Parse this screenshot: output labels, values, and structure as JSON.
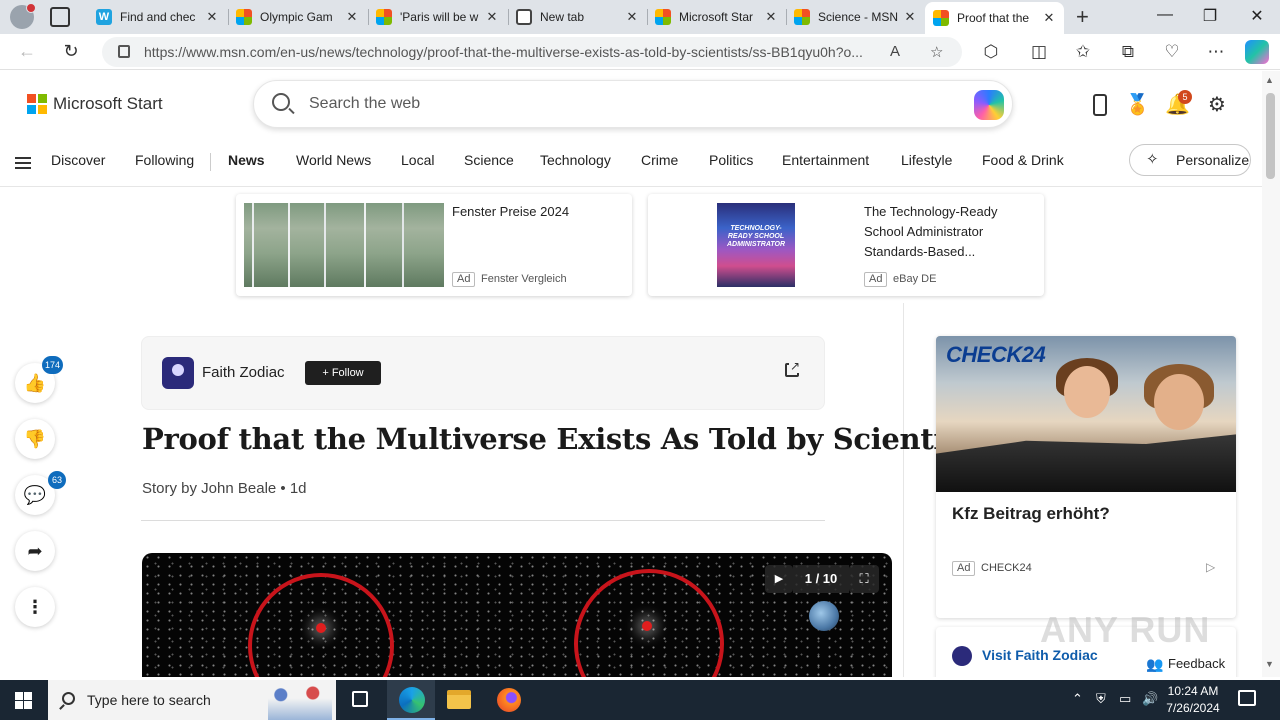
{
  "browser": {
    "tabs": [
      {
        "title": "Find and chec",
        "favicon": "w-icon"
      },
      {
        "title": "Olympic Gam",
        "favicon": "msn-icon"
      },
      {
        "title": "'Paris will be w",
        "favicon": "msn-icon"
      },
      {
        "title": "New tab",
        "favicon": "newtab-icon"
      },
      {
        "title": "Microsoft Star",
        "favicon": "msn-icon"
      },
      {
        "title": "Science - MSN",
        "favicon": "msn-icon"
      },
      {
        "title": "Proof that the",
        "favicon": "msn-icon",
        "active": true
      }
    ],
    "url": "https://www.msn.com/en-us/news/technology/proof-that-the-multiverse-exists-as-told-by-scientists/ss-BB1qyu0h?o..."
  },
  "header": {
    "brand": "Microsoft Start",
    "search_placeholder": "Search the web",
    "notification_count": "5"
  },
  "nav": {
    "items": [
      "Discover",
      "Following",
      "News",
      "World News",
      "Local",
      "Science",
      "Technology",
      "Crime",
      "Politics",
      "Entertainment",
      "Lifestyle",
      "Food & Drink"
    ],
    "active": "News",
    "personalize": "Personalize"
  },
  "ads": [
    {
      "title": "Fenster Preise 2024",
      "tag": "Ad",
      "source": "Fenster Vergleich"
    },
    {
      "title_lines": [
        "The Technology-Ready",
        "School Administrator",
        "Standards-Based..."
      ],
      "tag": "Ad",
      "source": "eBay DE",
      "book_cover_text": "TECHNOLOGY-READY SCHOOL ADMINISTRATOR"
    }
  ],
  "rail": {
    "likes": "174",
    "comments": "63"
  },
  "article": {
    "publisher": "Faith Zodiac",
    "follow_label": "+ Follow",
    "headline": "Proof that the Multiverse Exists As Told by Scientists",
    "byline": "Story by John Beale • 1d",
    "gallery_counter": "1 / 10"
  },
  "side_ad": {
    "logo": "CHECK24",
    "title": "Kfz Beitrag erhöht?",
    "tag": "Ad",
    "source": "CHECK24"
  },
  "visit": {
    "label": "Visit Faith Zodiac"
  },
  "feedback": "Feedback",
  "watermark": "ANY RUN",
  "taskbar": {
    "search_placeholder": "Type here to search",
    "time": "10:24 AM",
    "date": "7/26/2024"
  },
  "colors": {
    "accent": "#0f6cbd",
    "notification_badge": "#d1481c",
    "ring_red": "#c8141b",
    "check24_blue": "#0b3d91"
  }
}
